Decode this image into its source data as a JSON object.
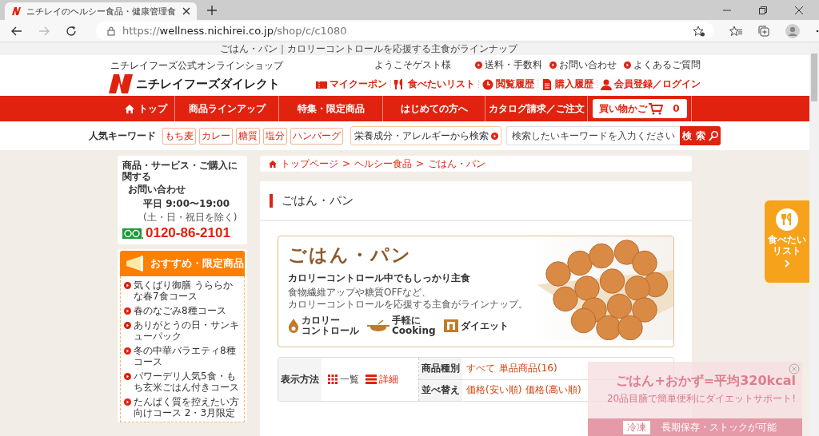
{
  "browser": {
    "tab_title": "ニチレイのヘルシー食品・健康管理食",
    "url": {
      "scheme": "https://",
      "host": "wellness.nichirei.co.jp",
      "path": "/shop/c/c1080"
    }
  },
  "page_title": "ごはん・パン｜カロリーコントロールを応援する主食がラインナップ",
  "header": {
    "tagline": "ニチレイフーズ公式オンラインショップ",
    "logo_text": "ニチレイフーズダイレクト",
    "welcome": "ようこそゲスト様",
    "top_links": [
      "送料・手数料",
      "お問い合わせ",
      "よくあるご質問"
    ],
    "links": [
      {
        "kind": "coupon",
        "label": "マイクーポン"
      },
      {
        "kind": "wish",
        "label": "食べたいリスト"
      },
      {
        "kind": "history",
        "label": "閲覧履歴"
      },
      {
        "kind": "purchase",
        "label": "購入履歴"
      },
      {
        "kind": "member",
        "label": "会員登録／ログイン"
      }
    ]
  },
  "nav": {
    "items": [
      {
        "kind": "home",
        "label": "トップ"
      },
      {
        "kind": "text",
        "label": "商品ラインアップ"
      },
      {
        "kind": "text",
        "label": "特集・限定商品"
      },
      {
        "kind": "text",
        "label": "はじめての方へ"
      },
      {
        "kind": "text",
        "label": "カタログ請求／ご注文"
      }
    ],
    "cart": {
      "label": "買い物かご",
      "count": "0"
    }
  },
  "keywords": {
    "label": "人気キーワード",
    "tags": [
      "もち麦",
      "カレー",
      "糖質",
      "塩分",
      "ハンバーグ"
    ],
    "allergy_search": "栄養成分・アレルギーから検索",
    "search_placeholder": "検索したいキーワードを入力ください",
    "search_button": "検 索"
  },
  "contact": {
    "heading": "商品・サービス・ご購入に関する",
    "title": "お問い合わせ",
    "hours": "平日 9:00〜19:00",
    "note": "(土・日・祝日を除く)",
    "phone": "0120-86-2101"
  },
  "recommend": {
    "title": "おすすめ・限定商品",
    "items": [
      "気くばり御膳 うららかな春7食コース",
      "春のなごみ8種コース",
      "ありがとうの日・サンキューパック",
      "冬の中華バラエティ8種コース",
      "パワーデリ人気5食・もち玄米ごはん付きコース",
      "たんぱく質を控えたい方向けコース 2・3月限定"
    ]
  },
  "breadcrumb": {
    "items": [
      "トップページ",
      "ヘルシー食品",
      "ごはん・パン"
    ],
    "separators": [
      ">",
      ">"
    ]
  },
  "category_title": "ごはん・パン",
  "banner": {
    "title": "ごはん・パン",
    "subtitle": "カロリーコントロール中でもしっかり主食",
    "lines": [
      "食物繊維アップや糖質OFFなど、",
      "カロリーコントロールを応援する主食がラインナップ。"
    ],
    "features": [
      {
        "kind": "flame",
        "lines": [
          "カロリー",
          "コントロール"
        ]
      },
      {
        "kind": "pot",
        "lines": [
          "手軽に",
          "Cooking"
        ]
      },
      {
        "kind": "diet",
        "lines": [
          "ダイエット"
        ]
      }
    ]
  },
  "display": {
    "label": "表示方法",
    "options": [
      {
        "kind": "grid",
        "label": "一覧"
      },
      {
        "kind": "list",
        "label": "詳細"
      }
    ],
    "filters": [
      {
        "label": "商品種別",
        "options": [
          "すべて",
          "単品商品(16)"
        ]
      },
      {
        "label": "並べ替え",
        "options": [
          "価格(安い順)",
          "価格(高い順)"
        ]
      }
    ]
  },
  "side_tab": {
    "label": "食べたいリスト"
  },
  "ad": {
    "headline": "ごはん+おかず=平均320kcal",
    "sub": "20品目膳で簡単便利にダイエットサポート!",
    "tag": "冷凍",
    "note": "長期保存・ストックが可能"
  }
}
